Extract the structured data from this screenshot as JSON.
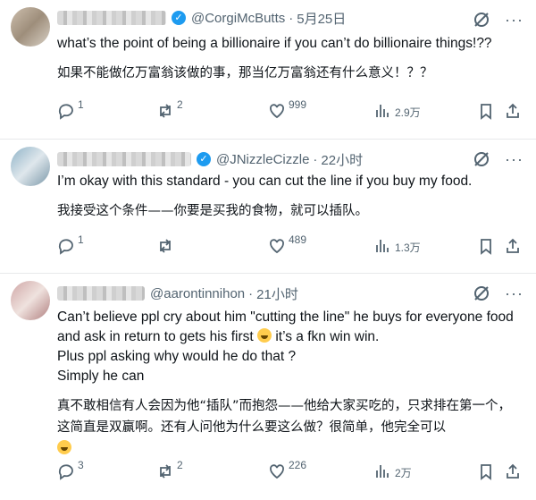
{
  "tweets": [
    {
      "handle": "@CorgiMcButts",
      "time": "5月25日",
      "text_en": "what’s the point of being a billionaire if you can’t do billionaire things!??",
      "text_cn": "如果不能做亿万富翁该做的事，那当亿万富翁还有什么意义！？？",
      "replies": "1",
      "retweets": "2",
      "likes": "999",
      "views": "2.9万"
    },
    {
      "handle": "@JNizzleCizzle",
      "time": "22小时",
      "text_en": "I’m okay with this standard - you can cut the line if you buy my food.",
      "text_cn": "我接受这个条件——你要是买我的食物，就可以插队。",
      "replies": "1",
      "retweets": "",
      "likes": "489",
      "views": "1.3万"
    },
    {
      "handle": "@aarontinnihon",
      "time": "21小时",
      "text_en_1": "Can’t believe ppl cry about him \"cutting the line\" he buys for everyone food and ask in return to gets his first",
      "text_en_2": "it’s a fkn win win.",
      "text_en_3": "Plus ppl asking why would he do that ?",
      "text_en_4": "Simply he can",
      "text_cn": "真不敢相信有人会因为他“插队”而抱怨——他给大家买吃的，只求排在第一个，这简直是双赢啊。还有人问他为什么要这么做？很简单，他完全可以",
      "replies": "3",
      "retweets": "2",
      "likes": "226",
      "views": "2万"
    }
  ],
  "icons": {
    "verified": "verified-badge-icon",
    "grok": "grok-icon",
    "more": "more-icon",
    "reply": "reply-icon",
    "retweet": "retweet-icon",
    "like": "heart-icon",
    "views": "views-icon",
    "bookmark": "bookmark-icon",
    "share": "share-icon"
  },
  "colors": {
    "text": "#0f1419",
    "secondary": "#536471",
    "verified": "#1d9bf0",
    "divider": "#e7e9eb"
  }
}
